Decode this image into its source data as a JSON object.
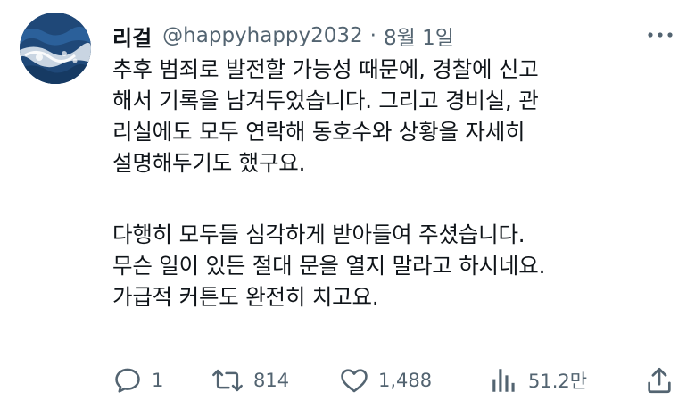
{
  "author": {
    "display_name": "리걸",
    "handle": "@happyhappy2032",
    "separator": "·",
    "date": "8월 1일"
  },
  "tweet": {
    "paragraph1": [
      "추후 범죄로 발전할 가능성 때문에, 경찰에 신고",
      "해서 기록을 남겨두었습니다. 그리고 경비실, 관",
      "리실에도 모두 연락해 동호수와 상황을 자세히",
      "설명해두기도 했구요."
    ],
    "paragraph2": [
      "다행히 모두들 심각하게 받아들여 주셨습니다.",
      "무슨 일이 있든 절대 문을 열지 말라고 하시네요.",
      "가급적 커튼도 완전히 치고요."
    ]
  },
  "actions": {
    "reply": {
      "icon": "reply-icon",
      "count": "1"
    },
    "retweet": {
      "icon": "retweet-icon",
      "count": "814"
    },
    "like": {
      "icon": "heart-icon",
      "count": "1,488"
    },
    "views": {
      "icon": "views-icon",
      "count": "51.2만"
    },
    "share": {
      "icon": "share-icon"
    }
  },
  "colors": {
    "text": "#0f1419",
    "secondary": "#536471",
    "background": "#ffffff"
  }
}
